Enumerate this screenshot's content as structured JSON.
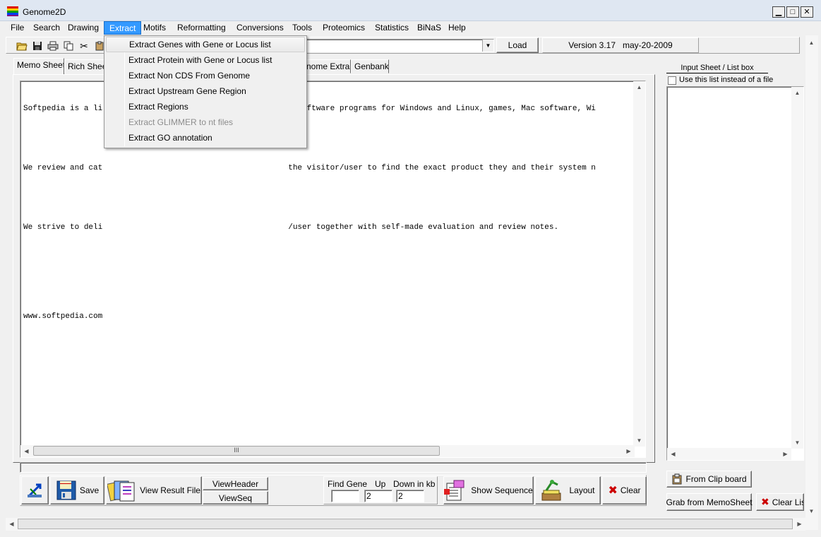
{
  "window": {
    "title": "Genome2D"
  },
  "menubar": {
    "items": [
      "File",
      "Search",
      "Drawing",
      "Extract",
      "Motifs",
      "Reformatting",
      "Conversions",
      "Tools",
      "Proteomics",
      "Statistics",
      "BiNaS",
      "Help"
    ],
    "active": "Extract"
  },
  "extract_menu": {
    "items": [
      {
        "label": "Extract Genes with Gene or Locus list",
        "enabled": true
      },
      {
        "label": "Extract Protein with Gene or Locus list",
        "enabled": true
      },
      {
        "label": "Extract Non CDS From Genome",
        "enabled": true
      },
      {
        "label": "Extract Upstream Gene Region",
        "enabled": true
      },
      {
        "label": "Extract Regions",
        "enabled": true
      },
      {
        "label": "Extract GLIMMER to nt files",
        "enabled": false
      },
      {
        "label": "Extract GO annotation",
        "enabled": true
      }
    ]
  },
  "toolbar": {
    "load_label": "Load",
    "version_label": "Version 3.17   may-20-2009",
    "combo_value": ""
  },
  "tabs": {
    "memo": "Memo Sheet",
    "rich": "Rich Sheet",
    "genome_extras": "nome Extras",
    "genbank": "Genbank"
  },
  "memo": {
    "lines": [
      "Softpedia is a li",
      "We review and cat",
      "We strive to deli",
      "www.softpedia.com"
    ],
    "line_tails": [
      "y software programs for Windows and Linux, games, Mac software, Wi",
      "the visitor/user to find the exact product they and their system n",
      "/user together with self-made evaluation and review notes.",
      ""
    ],
    "scroll_grip": "III"
  },
  "bottom_toolbar": {
    "save_label": "Save",
    "view_result_label": "View Result File",
    "view_header_label": "ViewHeader",
    "view_seq_label": "ViewSeq",
    "find_gene_label": "Find Gene",
    "up_label": "Up",
    "down_label": "Down in kb",
    "find_gene_value": "",
    "up_value": "2",
    "down_value": "2",
    "show_sequence_label": "Show Sequence",
    "layout_label": "Layout",
    "clear_label": "Clear"
  },
  "right_panel": {
    "title": "Input Sheet / List box",
    "checkbox_label": "Use this list instead of a file",
    "from_clipboard_label": "From Clip board",
    "grab_memo_label": "Grab from MemoSheet",
    "clear_list_label": "Clear List"
  },
  "colors": {
    "menu_highlight": "#3399ff",
    "clear_x": "#cc0000",
    "face": "#f0f0f0"
  }
}
